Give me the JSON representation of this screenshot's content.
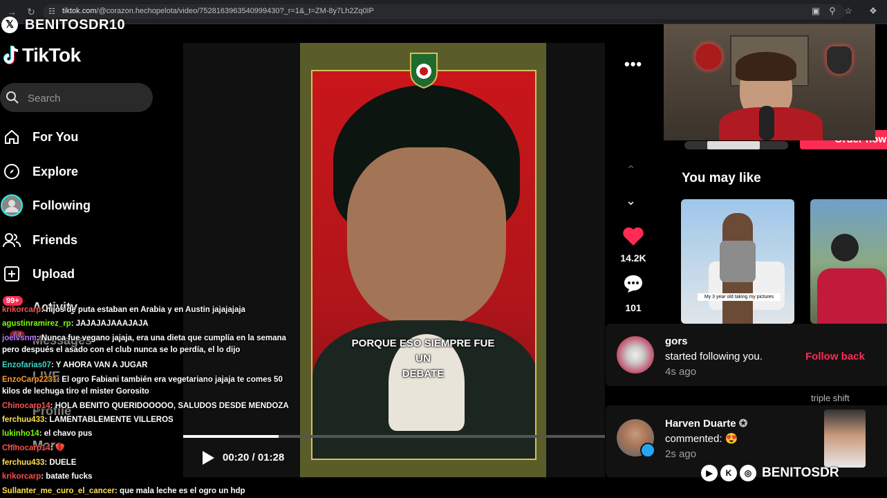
{
  "browser": {
    "url_host": "tiktok.com",
    "url_path": "/@corazon.hechopelota/video/7528163963540999430?_r=1&_t=ZM-8y7Lh2Zq0IP"
  },
  "stream_overlay": {
    "x_handle": "BENITOSDR10",
    "social_handle": "BENITOSDR"
  },
  "sidebar": {
    "logo": "TikTok",
    "search_placeholder": "Search",
    "items": [
      {
        "label": "For You",
        "icon": "home-icon"
      },
      {
        "label": "Explore",
        "icon": "compass-icon"
      },
      {
        "label": "Following",
        "icon": "following-avatar"
      },
      {
        "label": "Friends",
        "icon": "friends-icon"
      },
      {
        "label": "Upload",
        "icon": "upload-icon"
      },
      {
        "label": "Activity",
        "icon": "activity-icon",
        "badge": "99+"
      },
      {
        "label": "Messages",
        "icon": "messages-icon",
        "badge": "64"
      },
      {
        "label": "LIVE",
        "icon": "live-icon"
      },
      {
        "label": "Profile",
        "icon": "profile-avatar"
      },
      {
        "label": "More",
        "icon": "more-icon"
      }
    ]
  },
  "video": {
    "caption_line1": "PORQUE ESO SIEMPRE FUE UN",
    "caption_line2": "DEBATE",
    "current_time": "00:20",
    "duration": "01:28",
    "time_display": "00:20 / 01:28",
    "progress_fraction": 0.227,
    "likes": "14.2K",
    "comments": "101"
  },
  "recommendations": {
    "heading": "You may like",
    "thumb1_caption": "My 3 year old taking my pictures"
  },
  "partial_right_text": {
    "order_now": "Order now",
    "triple_shift": "triple shift"
  },
  "notifications": [
    {
      "name": "gors",
      "text": "started following you.",
      "time": "4s ago",
      "action": "Follow back"
    },
    {
      "name": "Harven Duarte",
      "text": "commented: 😍",
      "time": "2s ago"
    }
  ],
  "chat": [
    {
      "user": "krikorcarp",
      "msg": ": hijos de puta estaban en Arabia y en Austin jajajajaja",
      "color": "#ff4d4d"
    },
    {
      "user": "agustinramirez_rp",
      "msg": ": JAJAJAJAAAJAJA",
      "color": "#7CFC00"
    },
    {
      "user": "joelvsnm",
      "msg": ": Nunca fue vegano jajaja, era una dieta que cumplía en la semana",
      "msg2": "pero después el asado con el club nunca se lo perdía, el lo dijo",
      "color": "#b57aff"
    },
    {
      "user": "Enzofarias07",
      "msg": ": Y AHORA VAN A JUGAR",
      "color": "#3fd6c6"
    },
    {
      "user": "EnzoCarp2231",
      "msg": ": El ogro Fabiani también era vegetariano jajaja te comes 50",
      "msg2": "kilos de lechuga tiro el mister Gorosito",
      "color": "#ff9933"
    },
    {
      "user": "Chinocarp14",
      "msg": ": HOLA BENITO QUERIDOOOOO, SALUDOS DESDE MENDOZA",
      "color": "#ff4d4d"
    },
    {
      "user": "ferchuu433",
      "msg": ": LAMENTABLEMENTE VILLEROS",
      "color": "#ffe14d"
    },
    {
      "user": "lukinho14",
      "msg": ": el chavo pus",
      "color": "#7CFC00"
    },
    {
      "user": "Chinocarp14",
      "msg": ": 💔",
      "color": "#ff4d4d"
    },
    {
      "user": "ferchuu433",
      "msg": ": DUELE",
      "color": "#ffe14d"
    },
    {
      "user": "krikorcarp",
      "msg": ": batate fucks",
      "color": "#ff4d4d"
    },
    {
      "user": "Sullanter_me_curo_el_cancer",
      "msg": ": que mala leche es el ogro un hdp",
      "color": "#ffe14d"
    }
  ],
  "colors": {
    "accent": "#fe2c55",
    "background": "#000000",
    "panel": "#121212"
  }
}
